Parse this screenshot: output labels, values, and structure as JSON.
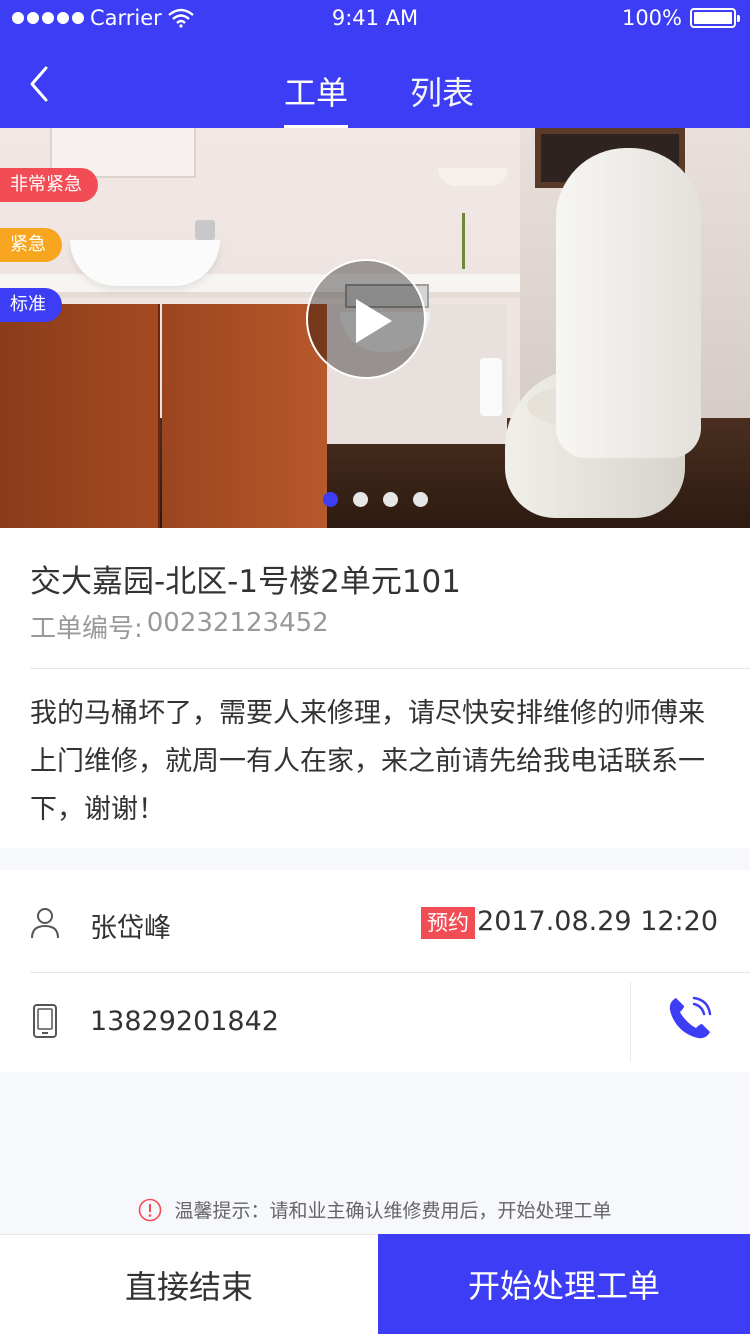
{
  "status_bar": {
    "carrier": "Carrier",
    "time": "9:41 AM",
    "battery": "100%"
  },
  "nav": {
    "tabs": [
      {
        "label": "工单",
        "active": true
      },
      {
        "label": "列表",
        "active": false
      }
    ],
    "accent_color": "#3d3df5"
  },
  "media": {
    "priority_tags": [
      {
        "label": "非常紧急",
        "color": "#f24d55"
      },
      {
        "label": "紧急",
        "color": "#f8a61f"
      },
      {
        "label": "标准",
        "color": "#3d3df5"
      }
    ],
    "pager": {
      "count": 4,
      "active_index": 0
    }
  },
  "order": {
    "address": "交大嘉园-北区-1号楼2单元101",
    "number_label": "工单编号:",
    "number": "00232123452",
    "description": "我的马桶坏了，需要人来修理，请尽快安排维修的师傅来上门维修，就周一有人在家，来之前请先给我电话联系一下，谢谢！"
  },
  "contact": {
    "name": "张岱峰",
    "badge": "预约",
    "appointment_time": "2017.08.29 12:20",
    "phone": "13829201842"
  },
  "tip": "温馨提示：请和业主确认维修费用后，开始处理工单",
  "actions": {
    "end_label": "直接结束",
    "start_label": "开始处理工单"
  }
}
